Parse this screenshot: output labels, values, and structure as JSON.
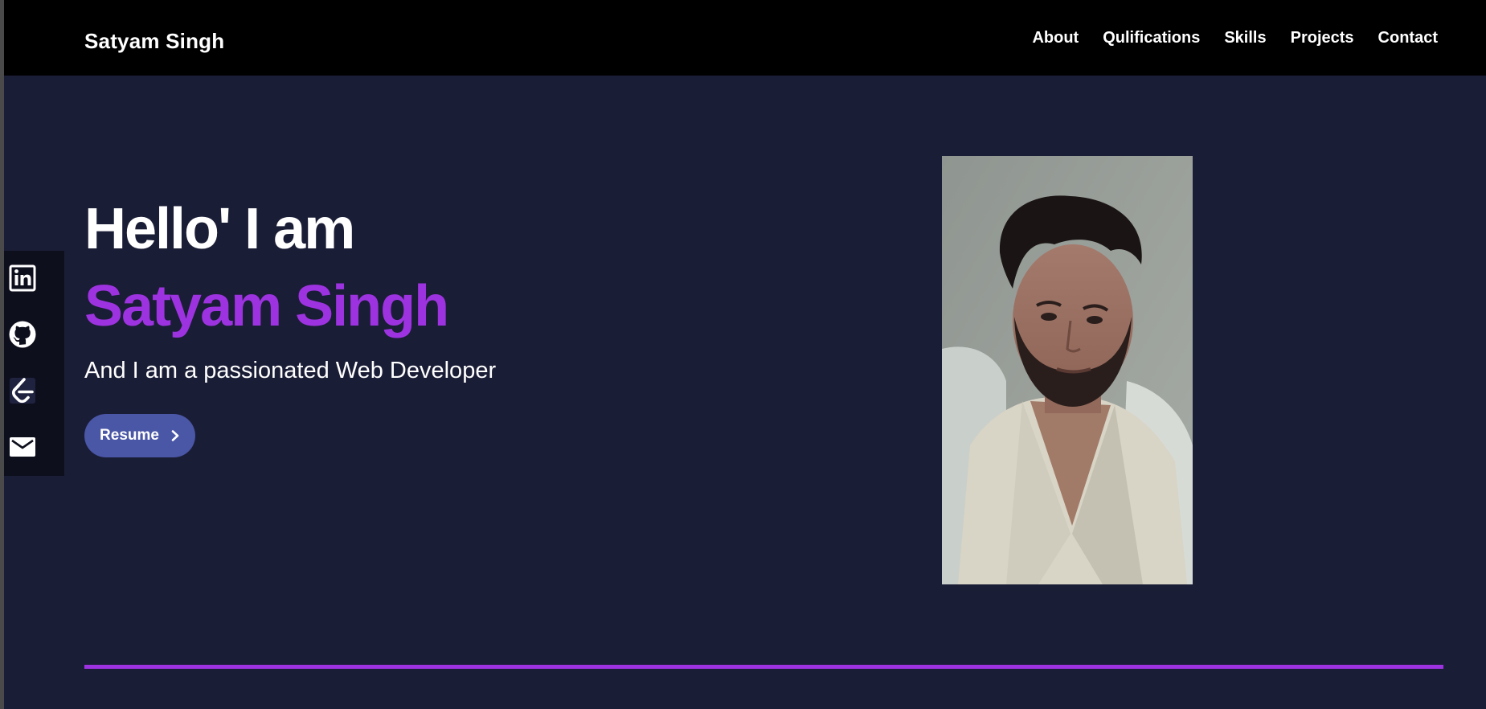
{
  "header": {
    "brand": "Satyam Singh",
    "nav": [
      {
        "label": "About"
      },
      {
        "label": "Qulifications"
      },
      {
        "label": "Skills"
      },
      {
        "label": "Projects"
      },
      {
        "label": "Contact"
      }
    ]
  },
  "social": [
    {
      "icon": "linkedin-icon"
    },
    {
      "icon": "github-icon"
    },
    {
      "icon": "leetcode-icon"
    },
    {
      "icon": "mail-icon"
    }
  ],
  "hero": {
    "greeting": "Hello' I am",
    "name": "Satyam Singh",
    "tagline": "And I am a passionated Web Developer",
    "resume_label": "Resume"
  },
  "colors": {
    "background": "#1a1d36",
    "header": "#000000",
    "accent": "#9d33e0",
    "button": "#4a56a6"
  }
}
